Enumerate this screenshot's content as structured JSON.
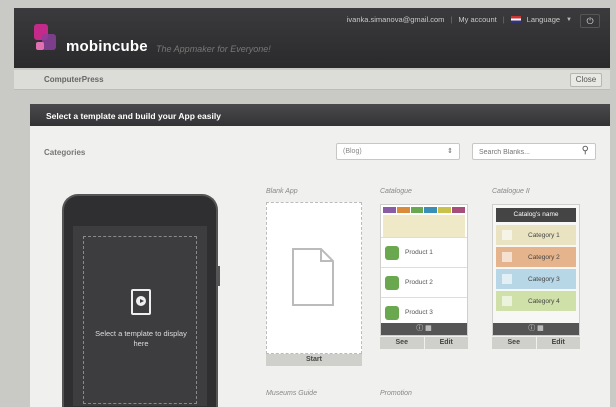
{
  "header": {
    "brand": "mobincube",
    "tagline": "The Appmaker for Everyone!",
    "email": "ivanka.simanova@gmail.com",
    "account_link": "My account",
    "language_label": "Language"
  },
  "project": {
    "name": "ComputerPress",
    "close_label": "Close"
  },
  "panel": {
    "title": "Select a template and build your App easily",
    "categories_label": "Categories",
    "category_select_value": "(Blog)",
    "search_placeholder": "Search Blanks..."
  },
  "phone": {
    "screen_text": "Select a template to display here"
  },
  "templates": {
    "blank": {
      "title": "Blank App",
      "start_label": "Start"
    },
    "catalogue": {
      "title": "Catalogue",
      "products": [
        "Product 1",
        "Product 2",
        "Product 3"
      ],
      "see_label": "See",
      "edit_label": "Edit"
    },
    "catalogue2": {
      "title": "Catalogue II",
      "header": "Catalog's name",
      "categories": [
        "Category 1",
        "Category 2",
        "Category 3",
        "Category 4"
      ],
      "see_label": "See",
      "edit_label": "Edit"
    },
    "row2": [
      "Museums Guide",
      "Promotion"
    ]
  },
  "colors": {
    "header_bg": "#2e2e30",
    "brand_magenta": "#c32a8a",
    "bag_green": "#6aa84f",
    "category_colors": [
      "#e9e3c2",
      "#e6b48c",
      "#b7d6e6",
      "#cfe0a8"
    ]
  }
}
